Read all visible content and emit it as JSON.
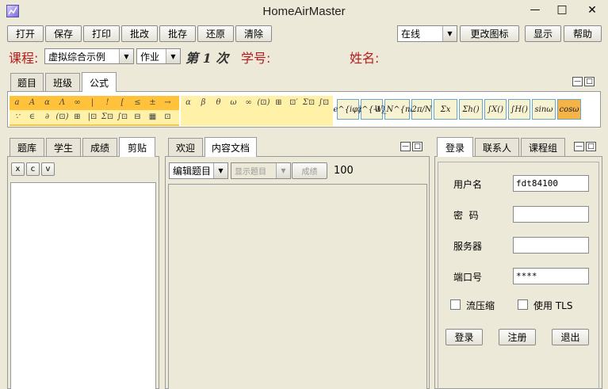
{
  "window": {
    "title": "HomeAirMaster",
    "minimize": "—",
    "maximize": "□",
    "close": "✕"
  },
  "toolbar": {
    "buttons": [
      "打开",
      "保存",
      "打印",
      "批改",
      "批存",
      "还原",
      "清除"
    ],
    "status_value": "在线",
    "change_icon": "更改图标",
    "show": "显示",
    "help": "帮助"
  },
  "course_bar": {
    "course_label": "课程:",
    "course_value": "虚拟综合示例",
    "type_value": "作业",
    "session_text": "第 1 次",
    "student_id_label": "学号:",
    "name_label": "姓名:"
  },
  "formula_panel": {
    "tabs": [
      "题目",
      "班级",
      "公式"
    ],
    "symbols_row1": [
      "a",
      "A",
      "α",
      "Λ",
      "∞",
      "|",
      "!",
      "[",
      "≤",
      "±",
      "→"
    ],
    "symbols_row2": [
      "∵",
      "∈",
      "∂",
      "(⊡)",
      "⊞",
      "|⊡",
      "Σ⊡",
      "∫⊡",
      "⊟",
      "▦",
      "⊡"
    ],
    "greek": [
      "α",
      "β",
      "θ",
      "ω",
      "∞",
      "(⊡)",
      "⊞",
      "⊡′",
      "Σ⊡",
      "∫⊡"
    ],
    "templates": [
      "e^{iφ}",
      "z^{-1}",
      "W_N^{nk}",
      "2π/N",
      "Σx",
      "Σh()",
      "∫X()",
      "∫H()",
      "sinω",
      "cosω"
    ]
  },
  "left_panel": {
    "tabs": [
      "题库",
      "学生",
      "成绩",
      "剪贴"
    ],
    "mini_buttons": [
      "x",
      "c",
      "v"
    ]
  },
  "middle_panel": {
    "tabs": [
      "欢迎",
      "内容文档"
    ],
    "edit_value": "编辑题目",
    "show_value": "显示题目",
    "grade_button": "成绩",
    "score": "100"
  },
  "login_panel": {
    "tabs": [
      "登录",
      "联系人",
      "课程组"
    ],
    "username_label": "用户名",
    "username_value": "fdt84100",
    "password_label": "密  码",
    "password_value": "",
    "server_label": "服务器",
    "server_value": "",
    "port_label": "端口号",
    "port_value": "****",
    "compress_label": "流压缩",
    "tls_label": "使用 TLS",
    "login_button": "登录",
    "register_button": "注册",
    "exit_button": "退出"
  },
  "colors": {
    "accent_red": "#b81c1c",
    "formula_yellow": "#fff2a8",
    "formula_orange": "#ffc23a",
    "selected_orange": "#f5b447"
  }
}
